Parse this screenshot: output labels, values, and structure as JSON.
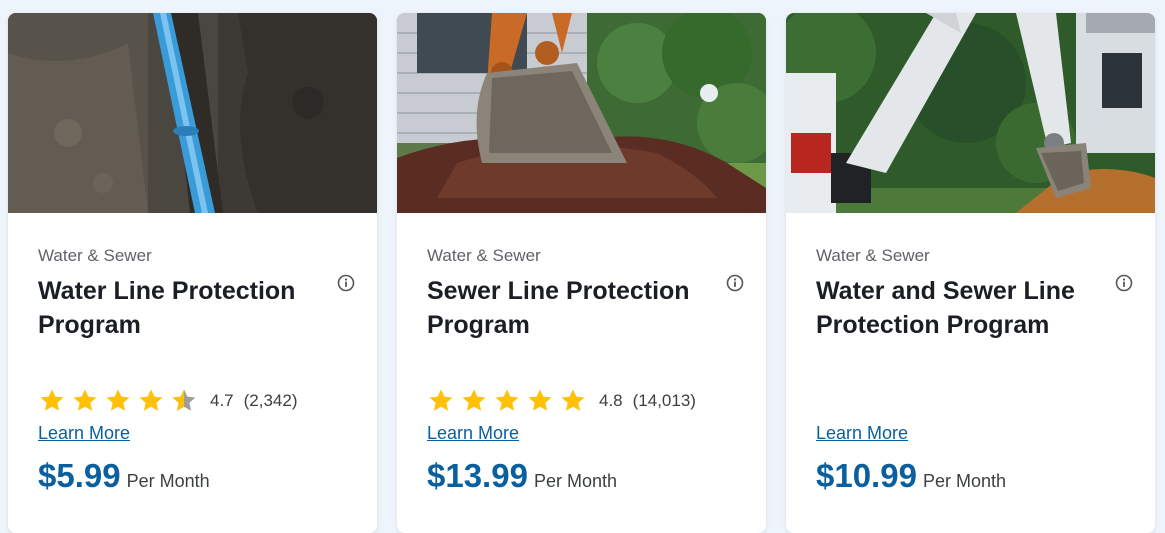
{
  "colors": {
    "accent": "#0a5f9e",
    "star": "#ffc107",
    "star_empty": "#9e9e9e",
    "background": "#eef4fb"
  },
  "cards": [
    {
      "image_name": "water-pipe-trench-image",
      "category": "Water & Sewer",
      "title": "Water Line Protection Program",
      "info_icon": "info-icon",
      "rating": {
        "stars": 4.5,
        "value": "4.7",
        "count": "(2,342)"
      },
      "learn_more": "Learn More",
      "price": "$5.99",
      "per": "Per Month"
    },
    {
      "image_name": "excavator-digging-yard-image",
      "category": "Water & Sewer",
      "title": "Sewer Line Protection Program",
      "info_icon": "info-icon",
      "rating": {
        "stars": 5,
        "value": "4.8",
        "count": "(14,013)"
      },
      "learn_more": "Learn More",
      "price": "$13.99",
      "per": "Per Month"
    },
    {
      "image_name": "excavator-near-house-image",
      "category": "Water & Sewer",
      "title": "Water and Sewer Line Protection Program",
      "info_icon": "info-icon",
      "rating": null,
      "learn_more": "Learn More",
      "price": "$10.99",
      "per": "Per Month"
    }
  ]
}
